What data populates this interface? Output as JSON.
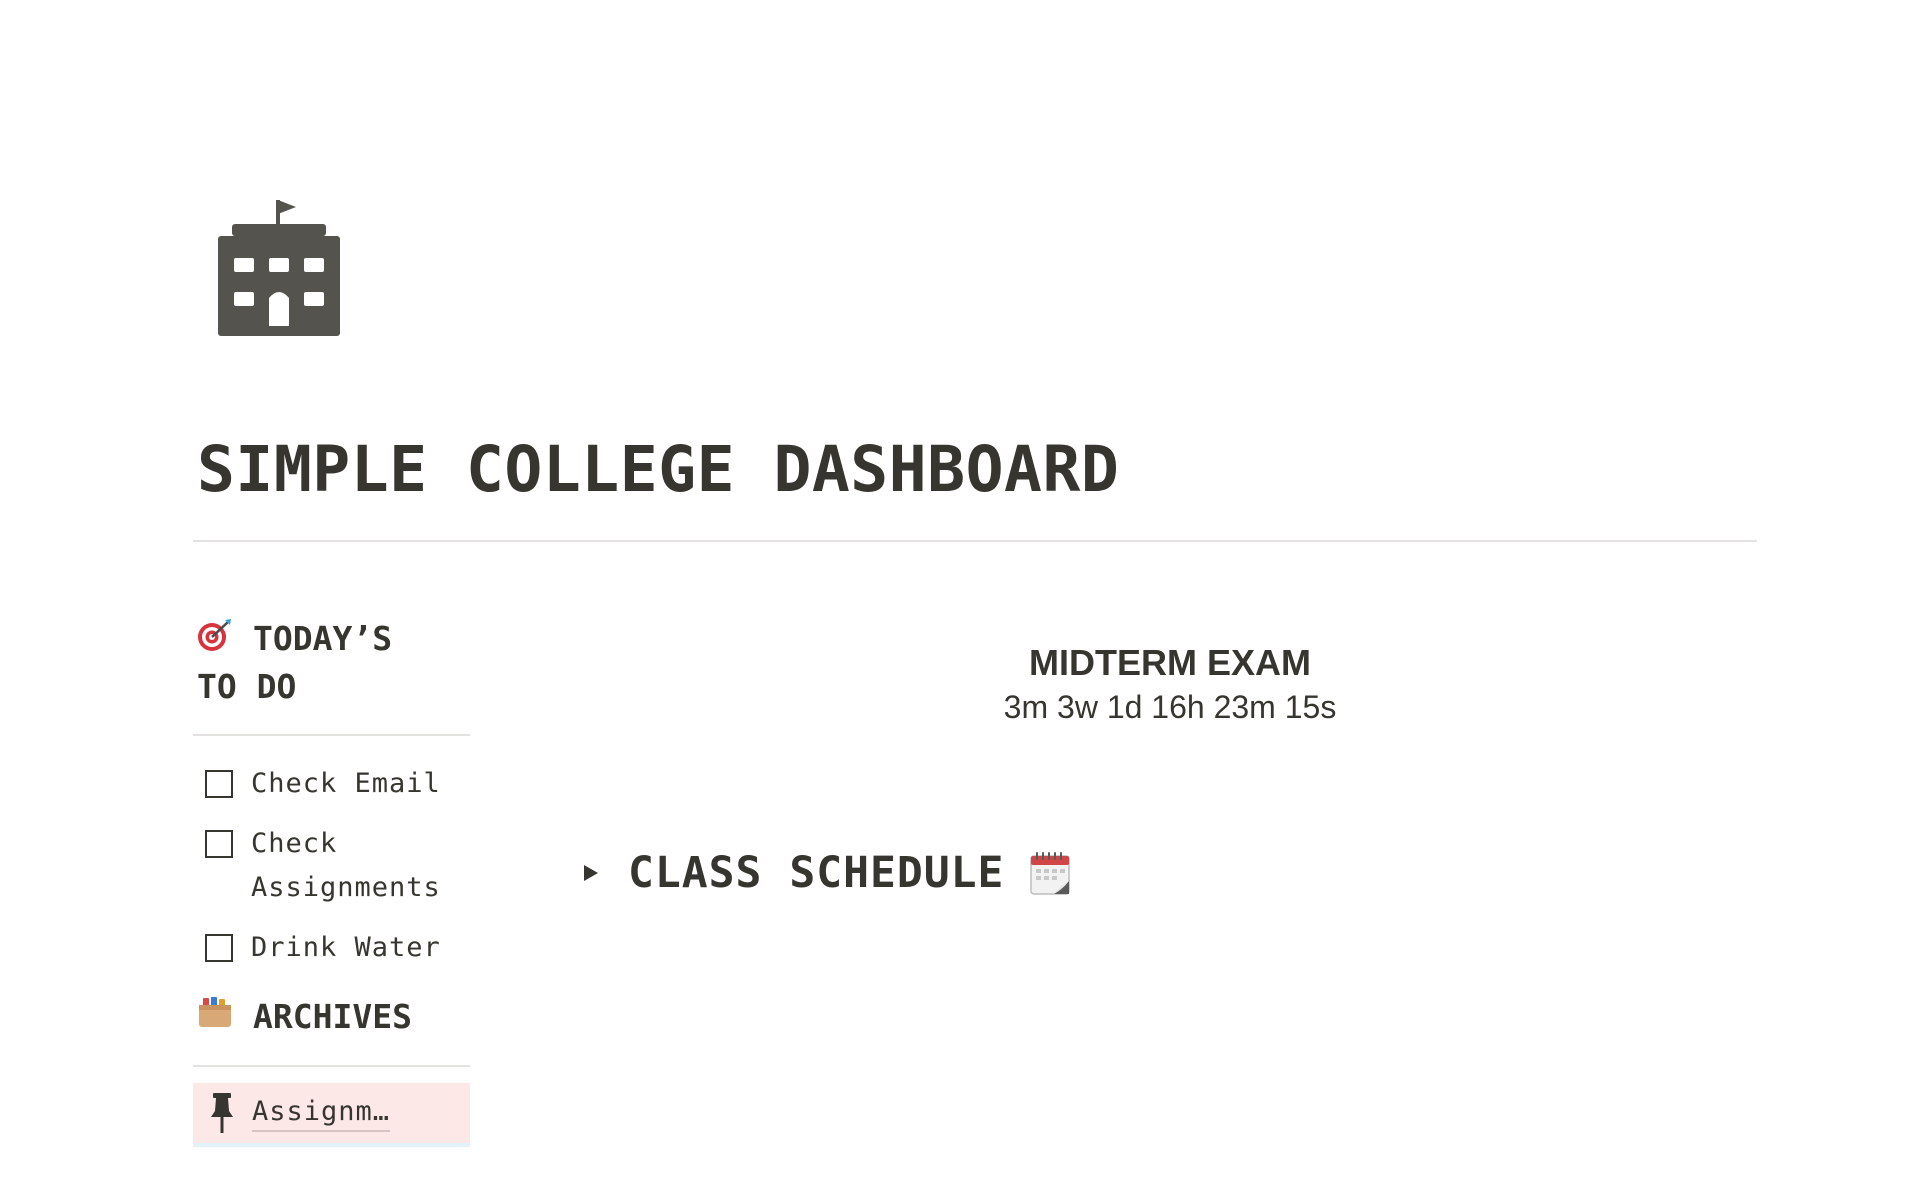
{
  "page": {
    "icon": "school-building-icon",
    "title": "SIMPLE COLLEGE DASHBOARD"
  },
  "todo": {
    "icon": "direct-hit-target-emoji",
    "heading_line1": "TODAY’S",
    "heading_line2": "TO DO",
    "items": [
      {
        "label": "Check Email",
        "checked": false
      },
      {
        "label": "Check",
        "label_line2": "Assignments",
        "checked": false
      },
      {
        "label": "Drink Water",
        "checked": false
      }
    ]
  },
  "archives": {
    "icon": "card-file-box-emoji",
    "heading": "ARCHIVES",
    "items": [
      {
        "icon": "pushpin-icon",
        "label": "Assignm…",
        "background": "#fde8e8"
      }
    ]
  },
  "countdown": {
    "title": "MIDTERM EXAM",
    "value": "3m 3w 1d 16h 23m 15s"
  },
  "class_schedule": {
    "toggle_icon": "triangle-right-icon",
    "label": "CLASS SCHEDULE",
    "icon": "spiral-calendar-emoji",
    "expanded": false
  },
  "colors": {
    "text": "#37352f",
    "divider": "#e3e2e0",
    "archive_highlight": "#fde8e8"
  }
}
